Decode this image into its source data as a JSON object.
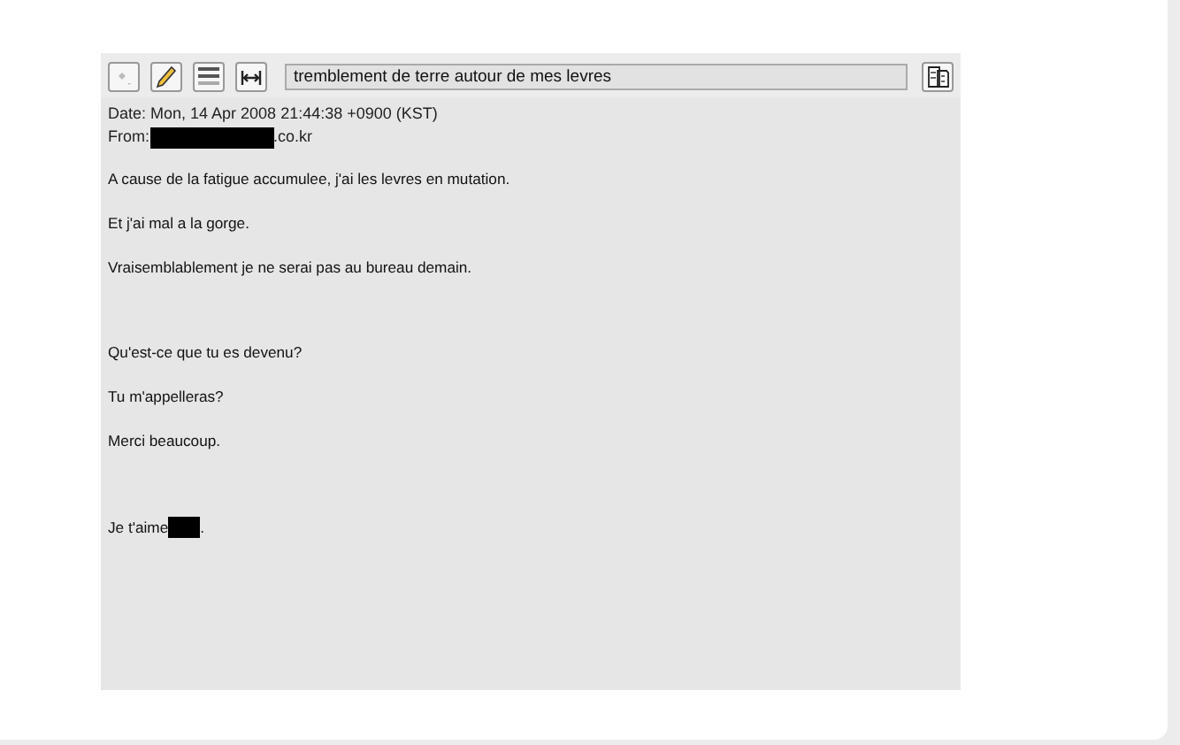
{
  "toolbar": {
    "subject": "tremblement de terre autour de mes levres"
  },
  "header": {
    "date": "Date: Mon, 14 Apr 2008 21:44:38 +0900 (KST)",
    "from_label": "From:",
    "from_suffix": ".co.kr"
  },
  "body": [
    [
      "A cause de la fatigue accumulee, j'ai les levres en mutation.",
      "Et j'ai mal a la gorge.",
      "Vraisemblablement je ne serai pas au bureau demain."
    ],
    [
      "Qu'est-ce que tu es devenu?",
      "Tu m'appelleras?",
      "Merci beaucoup."
    ]
  ],
  "signature": {
    "text": "Je t'aime",
    "end": "."
  }
}
